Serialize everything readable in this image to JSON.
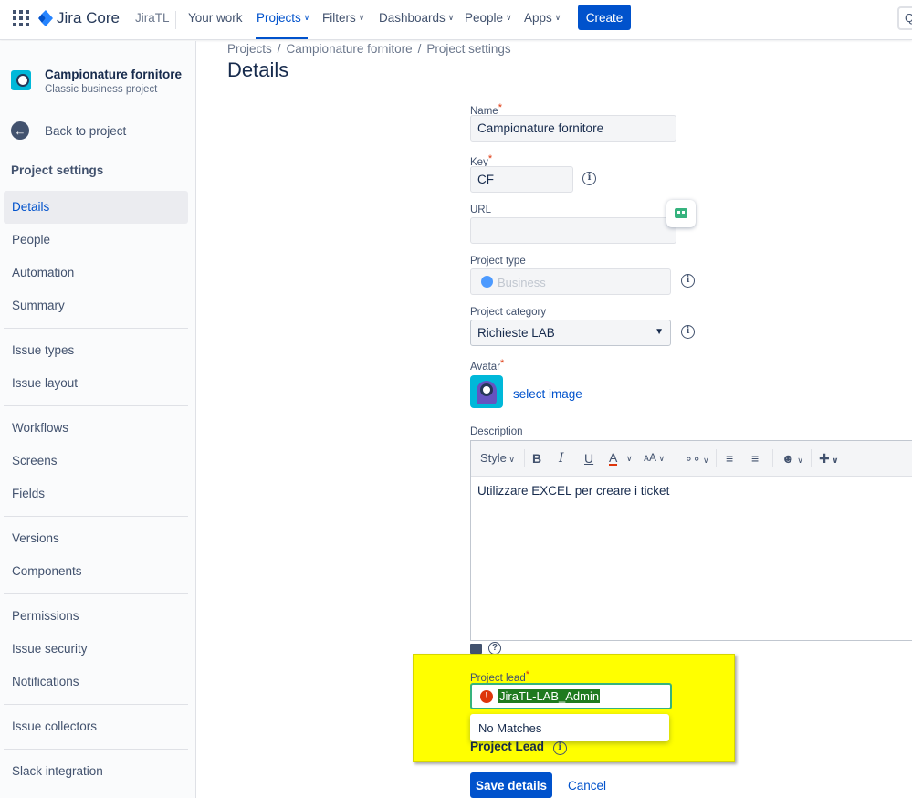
{
  "topnav": {
    "logo_text": "Jira Core",
    "site_name": "JiraTL",
    "items": [
      {
        "label": "Your work"
      },
      {
        "label": "Projects"
      },
      {
        "label": "Filters"
      },
      {
        "label": "Dashboards"
      },
      {
        "label": "People"
      },
      {
        "label": "Apps"
      }
    ],
    "create_label": "Create",
    "search_stub": "Q",
    "accent_color": "#0052cc"
  },
  "sidebar": {
    "project_name": "Campionature fornitore",
    "project_type": "Classic business project",
    "back_label": "Back to project",
    "heading": "Project settings",
    "items": [
      {
        "label": "Details",
        "selected": true
      },
      {
        "label": "People"
      },
      {
        "label": "Automation"
      },
      {
        "label": "Summary"
      },
      {
        "label": "Issue types"
      },
      {
        "label": "Issue layout"
      },
      {
        "label": "Workflows"
      },
      {
        "label": "Screens"
      },
      {
        "label": "Fields"
      },
      {
        "label": "Versions"
      },
      {
        "label": "Components"
      },
      {
        "label": "Permissions"
      },
      {
        "label": "Issue security"
      },
      {
        "label": "Notifications"
      },
      {
        "label": "Issue collectors"
      },
      {
        "label": "Slack integration"
      }
    ]
  },
  "breadcrumb": [
    "Projects",
    "Campionature fornitore",
    "Project settings"
  ],
  "page_title": "Details",
  "form": {
    "name_label": "Name",
    "name_value": "Campionature fornitore",
    "key_label": "Key",
    "key_value": "CF",
    "url_label": "URL",
    "url_value": "",
    "type_label": "Project type",
    "type_value": "Business",
    "category_label": "Project category",
    "category_value": "Richieste LAB",
    "avatar_label": "Avatar",
    "select_image": "select image",
    "description_label": "Description",
    "description_value": "Utilizzare EXCEL per creare i ticket",
    "toolbar_style": "Style",
    "lead_label": "Project lead",
    "lead_value": "JiraTL-LAB_Admin",
    "lead_no_matches": "No Matches",
    "lead_heading": "Project Lead",
    "save_label": "Save details",
    "cancel_label": "Cancel",
    "highlight_color": "#ffff00"
  }
}
